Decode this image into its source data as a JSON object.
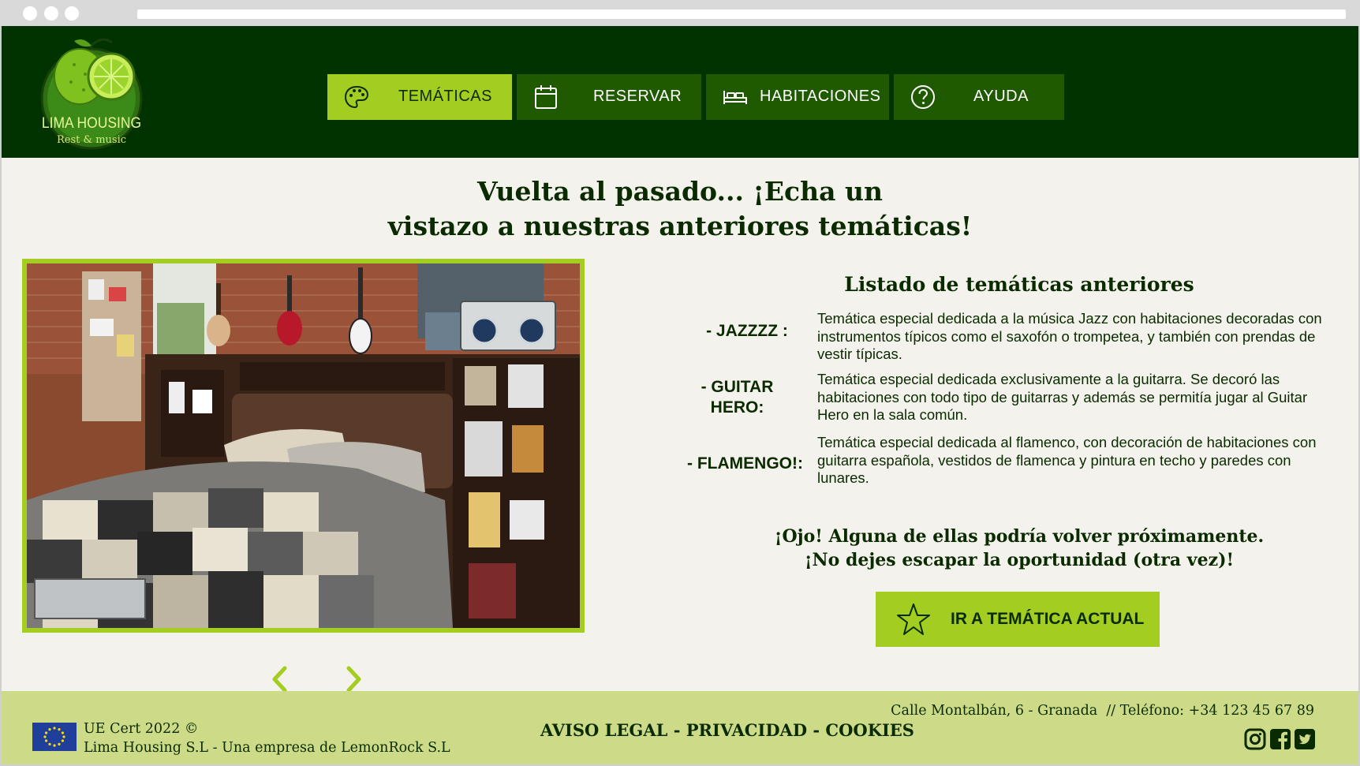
{
  "logo": {
    "name": "LIMA HOUSING",
    "tagline": "Rest & music"
  },
  "nav": [
    {
      "label": "TEMÁTICAS",
      "icon": "palette-icon",
      "active": true
    },
    {
      "label": "RESERVAR",
      "icon": "calendar-icon",
      "active": false
    },
    {
      "label": "HABITACIONES",
      "icon": "bed-icon",
      "active": false
    },
    {
      "label": "AYUDA",
      "icon": "question-icon",
      "active": false
    }
  ],
  "main": {
    "title_line1": "Vuelta al pasado... ¡Echa un",
    "title_line2": "vistazo a nuestras anteriores temáticas!"
  },
  "carousel": {
    "prev_icon": "chevron-left-icon",
    "next_icon": "chevron-right-icon",
    "image_icon": "bedroom-photo"
  },
  "themes": {
    "title": "Listado de temáticas anteriores",
    "items": [
      {
        "name": "- JAZZZZ :",
        "description": "Temática especial dedicada a la música Jazz con habitaciones decoradas con instrumentos típicos como el saxofón o trompetea, y también con prendas de vestir típicas."
      },
      {
        "name_line1": "- GUITAR",
        "name_line2": "HERO:",
        "description": "Temática especial dedicada exclusivamente a la guitarra. Se decoró las habitaciones con todo tipo de guitarras y además se permitía jugar al Guitar Hero en la sala común."
      },
      {
        "name": "- FLAMENGO!:",
        "description": "Temática especial dedicada al flamenco, con decoración de habitaciones con guitarra española, vestidos de flamenca y pintura en techo y paredes con lunares."
      }
    ]
  },
  "notice": {
    "line1": "¡Ojo! Alguna de ellas podría volver próximamente.",
    "line2": "¡No dejes escapar la oportunidad (otra vez)!"
  },
  "cta": {
    "label": "IR A TEMÁTICA ACTUAL",
    "icon": "star-icon"
  },
  "footer": {
    "cert_line1": "UE Cert 2022 ©",
    "cert_line2": "Lima Housing S.L - Una empresa de LemonRock S.L",
    "legal_aviso": "AVISO LEGAL",
    "legal_privacidad": "PRIVACIDAD",
    "legal_cookies": "COOKIES",
    "legal_sep": " - ",
    "contact": "Calle Montalbán, 6 - Granada  // Teléfono: +34 123 45 67 89",
    "social": [
      "instagram-icon",
      "facebook-icon",
      "twitter-icon"
    ]
  },
  "colors": {
    "header_bg": "#003300",
    "nav_bg": "#1f5a00",
    "accent": "#a3cd20",
    "page_bg": "#f4f2ec",
    "footer_bg": "#cddb88",
    "text_dark": "#0a2a00"
  }
}
